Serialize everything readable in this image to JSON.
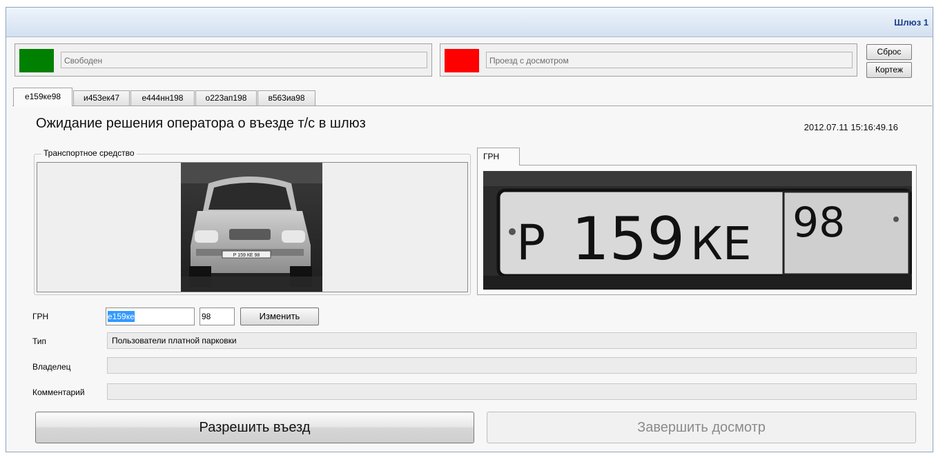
{
  "window": {
    "title": "Шлюз 1"
  },
  "status": {
    "left": {
      "text": "Свободен",
      "color": "#008000"
    },
    "right": {
      "text": "Проезд с досмотром",
      "color": "#ff0000"
    }
  },
  "side_buttons": {
    "reset": "Сброс",
    "cortege": "Кортеж"
  },
  "tabs": [
    "е159ке98",
    "и453ек47",
    "е444нн198",
    "о223ап198",
    "в563иа98"
  ],
  "active_tab": 0,
  "main": {
    "heading": "Ожидание решения оператора о въезде т/с в шлюз",
    "datetime": "2012.07.11 15:16:49.16",
    "vehicle_group": "Транспортное средство",
    "grn_tab": "ГРН",
    "car_plate_small": "P 159 КЕ 98",
    "plate": {
      "letter1": "P",
      "number": "159",
      "letters": "КЕ",
      "region": "98"
    }
  },
  "form": {
    "grn_label": "ГРН",
    "grn_value": "е159ке",
    "region_value": "98",
    "change_button": "Изменить",
    "type_label": "Тип",
    "type_value": "Пользователи платной парковки",
    "owner_label": "Владелец",
    "owner_value": "",
    "comment_label": "Комментарий",
    "comment_value": ""
  },
  "actions": {
    "allow": "Разрешить въезд",
    "finish": "Завершить досмотр"
  }
}
